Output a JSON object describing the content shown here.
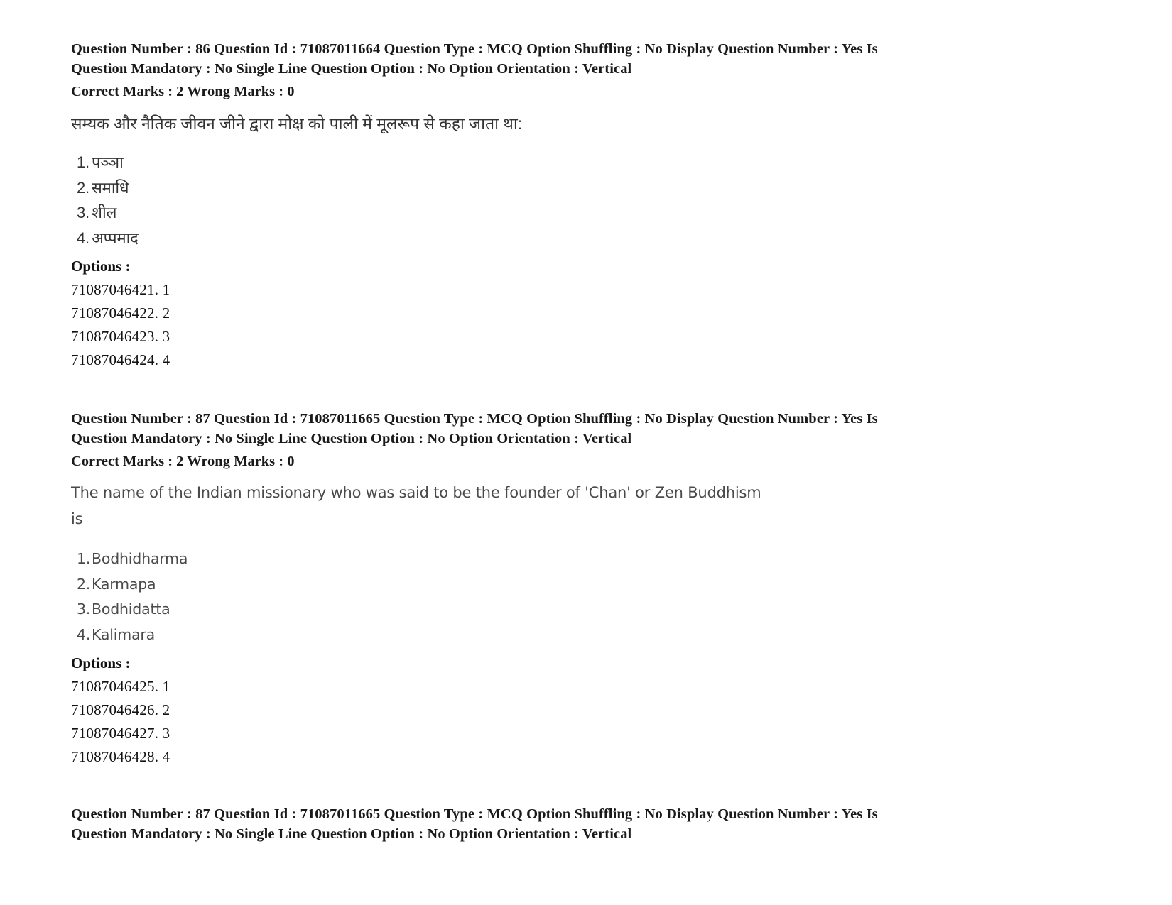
{
  "page": {
    "background": "#ffffff",
    "text_color": "#1a1a1a"
  },
  "questions": [
    {
      "meta_line_1": "Question Number : 86 Question Id : 71087011664 Question Type : MCQ Option Shuffling : No Display Question Number : Yes Is",
      "meta_line_2": "Question Mandatory : No Single Line Question Option : No Option Orientation : Vertical",
      "marks_line": "Correct Marks : 2 Wrong Marks : 0",
      "question_text_lines": [
        "सम्यक और नैतिक जीवन जीने द्वारा मोक्ष को पाली में मूलरूप से कहा जाता था:"
      ],
      "language": "hi",
      "choices": [
        {
          "num": "1.",
          "text": "पञ्ञा"
        },
        {
          "num": "2.",
          "text": "समाधि"
        },
        {
          "num": "3.",
          "text": "शील"
        },
        {
          "num": "4.",
          "text": "अप्पमाद"
        }
      ],
      "options_label": "Options :",
      "option_ids": [
        "71087046421. 1",
        "71087046422. 2",
        "71087046423. 3",
        "71087046424. 4"
      ]
    },
    {
      "meta_line_1": "Question Number : 87 Question Id : 71087011665 Question Type : MCQ Option Shuffling : No Display Question Number : Yes Is",
      "meta_line_2": "Question Mandatory : No Single Line Question Option : No Option Orientation : Vertical",
      "marks_line": "Correct Marks : 2 Wrong Marks : 0",
      "question_text_lines": [
        "The name of the Indian missionary who was said to be the founder of 'Chan' or Zen Buddhism",
        "is"
      ],
      "language": "en",
      "choices": [
        {
          "num": "1.",
          "text": "Bodhidharma"
        },
        {
          "num": "2.",
          "text": "Karmapa"
        },
        {
          "num": "3.",
          "text": "Bodhidatta"
        },
        {
          "num": "4.",
          "text": "Kalimara"
        }
      ],
      "options_label": "Options :",
      "option_ids": [
        "71087046425. 1",
        "71087046426. 2",
        "71087046427. 3",
        "71087046428. 4"
      ]
    }
  ],
  "footer_meta": {
    "meta_line_1": "Question Number : 87 Question Id : 71087011665 Question Type : MCQ Option Shuffling : No Display Question Number : Yes Is",
    "meta_line_2": "Question Mandatory : No Single Line Question Option : No Option Orientation : Vertical"
  }
}
